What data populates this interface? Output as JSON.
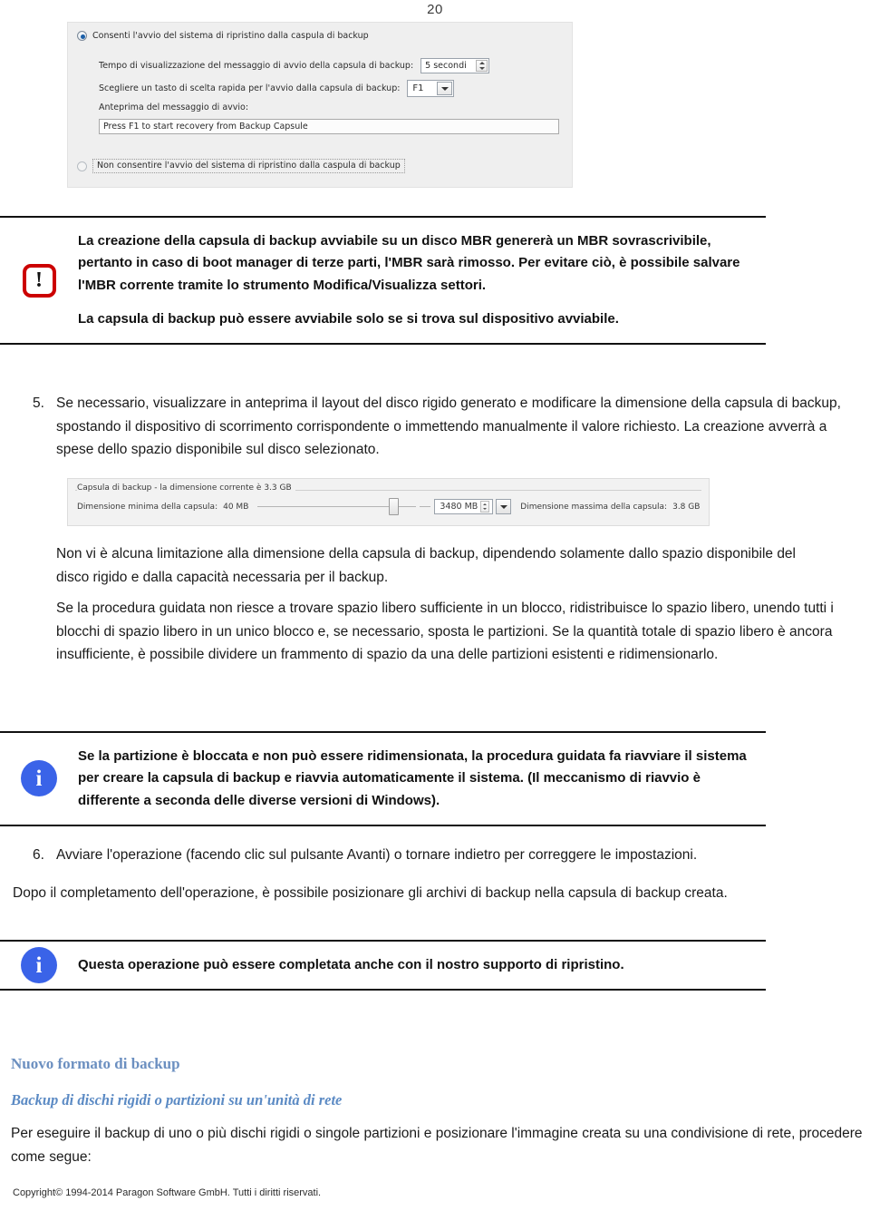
{
  "page": {
    "number": "20"
  },
  "boot_dialog": {
    "option_allow": "Consenti l'avvio del sistema di ripristino dalla caspula di backup",
    "option_deny": "Non consentire l'avvio del sistema di ripristino dalla caspula di backup",
    "timeout_label": "Tempo di visualizzazione del messaggio di avvio della capsula di backup:",
    "timeout_value": "5 secondi",
    "hotkey_label": "Scegliere un tasto di scelta rapida per l'avvio dalla capsula di backup:",
    "hotkey_value": "F1",
    "preview_label": "Anteprima del messaggio di avvio:",
    "preview_value": "Press F1 to start recovery from Backup Capsule"
  },
  "size_dialog": {
    "group_title": "Capsula di backup - la dimensione corrente è 3.3 GB",
    "min_label": "Dimensione minima della capsula:",
    "min_value": "40 MB",
    "current_value": "3480 MB",
    "max_label": "Dimensione massima della capsula:",
    "max_value": "3.8 GB"
  },
  "callout_warning": {
    "icon": "exclamation-icon",
    "glyph": "!",
    "color": "#cc0000",
    "paragraphs": [
      "La creazione della capsula di backup avviabile su un disco MBR genererà un MBR sovrascrivibile, pertanto in caso di boot manager di terze parti, l'MBR sarà rimosso. Per evitare ciò, è possibile salvare l'MBR corrente tramite lo strumento Modifica/Visualizza settori.",
      "La capsula di backup può essere avviabile solo se si trova sul dispositivo avviabile."
    ]
  },
  "callout_info_1": {
    "icon": "info-icon",
    "glyph": "i",
    "color": "#3a63e8",
    "text": "Se la partizione è bloccata e non può essere ridimensionata, la procedura guidata fa riavviare il sistema per creare la capsula di backup e riavvia automaticamente il sistema. (Il meccanismo di riavvio è differente a seconda delle diverse versioni di Windows)."
  },
  "callout_info_2": {
    "icon": "info-icon",
    "glyph": "i",
    "color": "#3a63e8",
    "text": "Questa operazione può essere completata anche con il nostro supporto di ripristino."
  },
  "steps": {
    "step5_number": "5.",
    "step5_text": "Se necessario, visualizzare in anteprima il layout del disco rigido generato e modificare la dimensione della capsula di backup, spostando il dispositivo di scorrimento corrispondente o immettendo manualmente il valore richiesto. La creazione avverrà a spese dello spazio disponibile sul disco selezionato.",
    "step6_number": "6.",
    "step6_text": "Avviare l'operazione (facendo clic sul pulsante Avanti) o tornare indietro per correggere le impostazioni."
  },
  "paragraphs": {
    "no_limit": "Non vi è alcuna limitazione alla dimensione della capsula di backup, dipendendo solamente dallo spazio disponibile del disco rigido e dalla capacità necessaria per il backup.",
    "wizard": "Se la procedura guidata non riesce a trovare spazio libero sufficiente in un blocco, ridistribuisce lo spazio libero, unendo tutti i blocchi di spazio libero in un unico blocco e, se necessario, sposta le partizioni. Se la quantità totale di spazio libero è ancora insufficiente, è possibile dividere un frammento di spazio da una delle partizioni esistenti e ridimensionarlo.",
    "after_operation": "Dopo il completamento dell'operazione, è possibile posizionare gli archivi di backup nella capsula di backup creata.",
    "intro_network": "Per eseguire il backup di uno o più dischi rigidi o singole partizioni e posizionare l'immagine creata su una condivisione di rete, procedere come segue:"
  },
  "headings": {
    "h1": "Nuovo formato di backup",
    "h1_color": "#6b8fc0",
    "h2": "Backup di dischi rigidi o partizioni su un'unità di rete",
    "h2_color": "#5b8ac4"
  },
  "footer": {
    "copyright": "Copyright© 1994-2014 Paragon Software GmbH. Tutti i diritti riservati."
  }
}
